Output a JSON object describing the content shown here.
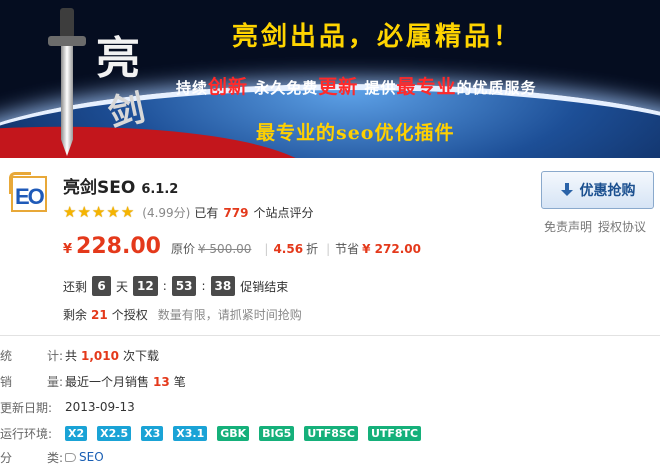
{
  "banner": {
    "calligraphy_top": "亮",
    "calligraphy_bottom": "剑",
    "slogan1": "亮剑出品，必属精品！",
    "slogan2": {
      "parts": [
        "持续",
        "创新",
        "  永久免费",
        "更新",
        "  提供",
        "最专业",
        "的优质服务"
      ]
    },
    "slogan3": "最专业的seo优化插件"
  },
  "product": {
    "logo_text": "EO",
    "name": "亮剑SEO",
    "version": "6.1.2",
    "rating": {
      "stars": 5,
      "score": "(4.99分)",
      "prefix": "已有",
      "count": "779",
      "suffix": "个站点评分"
    },
    "price": {
      "currency": "¥",
      "current": "228.00",
      "original_label": "原价",
      "original": "¥ 500.00",
      "discount": "4.56",
      "discount_unit": "折",
      "save_label": "节省",
      "save": "¥ 272.00"
    },
    "countdown": {
      "prefix": "还剩",
      "days": "6",
      "days_unit": "天",
      "hours": "12",
      "minutes": "53",
      "seconds": "38",
      "sep": ":",
      "suffix": "促销结束"
    },
    "remaining": {
      "prefix": "剩余",
      "count": "21",
      "suffix": "个授权",
      "note": "数量有限，请抓紧时间抢购"
    },
    "buy_button": "优惠抢购",
    "links": [
      "免责声明",
      "授权协议"
    ]
  },
  "details": {
    "stats": {
      "label_a": "统",
      "label_b": "计:",
      "prefix": "共",
      "value": "1,010",
      "suffix": "次下载"
    },
    "sales": {
      "label_a": "销",
      "label_b": "量:",
      "prefix": "最近一个月销售",
      "value": "13",
      "suffix": "笔"
    },
    "updated": {
      "label": "更新日期:",
      "value": "2013-09-13"
    },
    "env": {
      "label": "运行环境:",
      "tags": [
        {
          "text": "X2",
          "color": "#1aa3d6"
        },
        {
          "text": "X2.5",
          "color": "#1aa3d6"
        },
        {
          "text": "X3",
          "color": "#1aa3d6"
        },
        {
          "text": "X3.1",
          "color": "#1aa3d6"
        },
        {
          "text": "GBK",
          "color": "#15b07a"
        },
        {
          "text": "BIG5",
          "color": "#15b07a"
        },
        {
          "text": "UTF8SC",
          "color": "#15b07a"
        },
        {
          "text": "UTF8TC",
          "color": "#15b07a"
        }
      ]
    },
    "category": {
      "label_a": "分",
      "label_b": "类:",
      "value": "SEO"
    }
  }
}
